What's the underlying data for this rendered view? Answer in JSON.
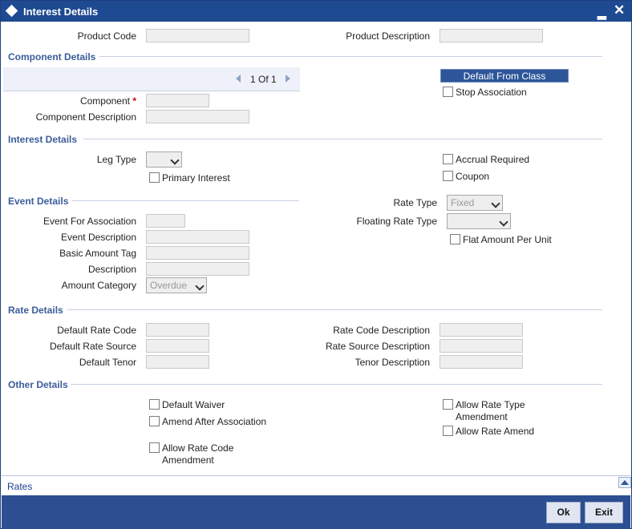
{
  "window": {
    "title": "Interest Details",
    "minimize": "▂",
    "close": "✕"
  },
  "header": {
    "product_code_label": "Product Code",
    "product_description_label": "Product Description"
  },
  "component_details": {
    "section_title": "Component Details",
    "pager": {
      "text": "1 Of 1"
    },
    "default_from_class_button": "Default From Class",
    "stop_association_label": "Stop Association",
    "component_label": "Component",
    "required_marker": "*",
    "component_description_label": "Component Description"
  },
  "interest_details": {
    "section_title": "Interest Details",
    "leg_type_label": "Leg Type",
    "primary_interest_label": "Primary Interest",
    "accrual_required_label": "Accrual Required",
    "coupon_label": "Coupon"
  },
  "event_details": {
    "section_title": "Event Details",
    "event_for_association_label": "Event For Association",
    "event_description_label": "Event Description",
    "basic_amount_tag_label": "Basic Amount Tag",
    "description_label": "Description",
    "amount_category_label": "Amount Category",
    "amount_category_value": "Overdue",
    "rate_type_label": "Rate Type",
    "rate_type_value": "Fixed",
    "floating_rate_type_label": "Floating Rate Type",
    "flat_amount_per_unit_label": "Flat Amount Per Unit"
  },
  "rate_details": {
    "section_title": "Rate Details",
    "default_rate_code_label": "Default Rate Code",
    "default_rate_source_label": "Default Rate Source",
    "default_tenor_label": "Default Tenor",
    "rate_code_description_label": "Rate Code Description",
    "rate_source_description_label": "Rate Source Description",
    "tenor_description_label": "Tenor Description"
  },
  "other_details": {
    "section_title": "Other Details",
    "default_waiver_label": "Default Waiver",
    "amend_after_association_label": "Amend After Association",
    "allow_rate_code_amendment_line1": "Allow Rate Code",
    "allow_rate_code_amendment_line2": "Amendment",
    "allow_rate_type_amendment_line1": "Allow Rate Type",
    "allow_rate_type_amendment_line2": "Amendment",
    "allow_rate_amend_label": "Allow Rate Amend"
  },
  "rates_bar": {
    "link": "Rates"
  },
  "footer": {
    "ok_label": "Ok",
    "exit_label": "Exit"
  }
}
